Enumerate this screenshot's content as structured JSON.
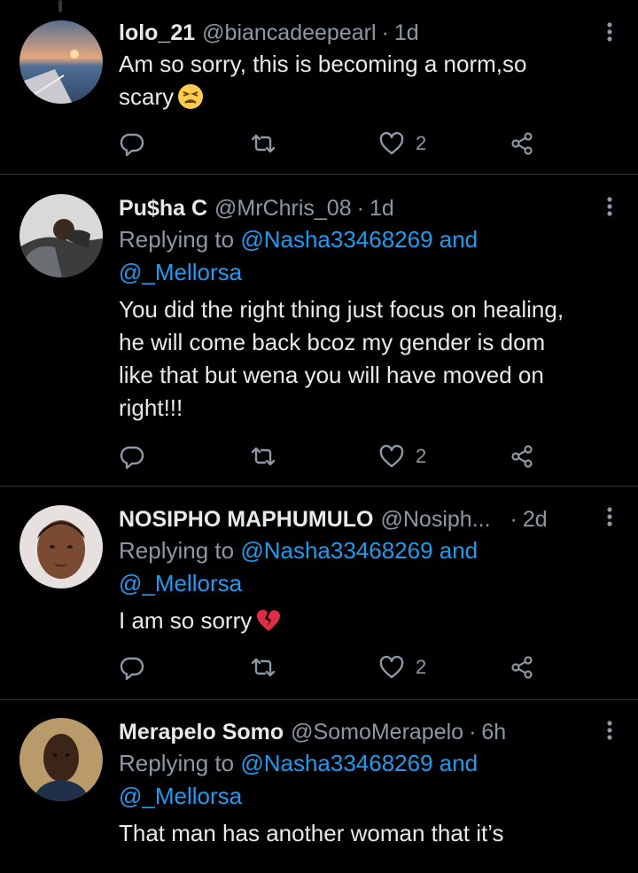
{
  "tweets": [
    {
      "name": "lolo_21",
      "handle": "@biancadeepearl",
      "time": "1d",
      "text_lines": [
        "Am so sorry, this is becoming a norm,so",
        "scary"
      ],
      "emoji": "tired-face-emoji",
      "likes": "2"
    },
    {
      "name": "Pu$ha C",
      "handle": "@MrChris_08",
      "time": "1d",
      "replying_prefix": "Replying to",
      "replying_to": "@Nasha33468269 and",
      "replying_to_2": "@_Mellorsa",
      "text_lines": [
        "You did the right thing just focus on healing,",
        "he will come back bcoz my gender is dom",
        "like that but wena you will have moved on",
        "right!!!"
      ],
      "likes": "2"
    },
    {
      "name": "NOSIPHO MAPHUMULO",
      "handle": "@Nosiph...",
      "time": "2d",
      "replying_prefix": "Replying to",
      "replying_to": "@Nasha33468269 and",
      "replying_to_2": "@_Mellorsa",
      "text_lines": [
        "I am so sorry"
      ],
      "emoji": "broken-heart-emoji",
      "likes": "2"
    },
    {
      "name": "Merapelo Somo",
      "handle": "@SomoMerapelo",
      "time": "6h",
      "replying_prefix": "Replying to",
      "replying_to": "@Nasha33468269 and",
      "replying_to_2": "@_Mellorsa",
      "text_lines": [
        "That man has another woman that it’s"
      ]
    }
  ],
  "colors": {
    "background": "#000000",
    "text": "#e7e9ea",
    "secondary": "#8b98a5",
    "mention": "#1d9bf0",
    "divider": "#2f3336"
  },
  "icons": [
    "reply-icon",
    "retweet-icon",
    "like-icon",
    "share-icon",
    "more-icon"
  ]
}
